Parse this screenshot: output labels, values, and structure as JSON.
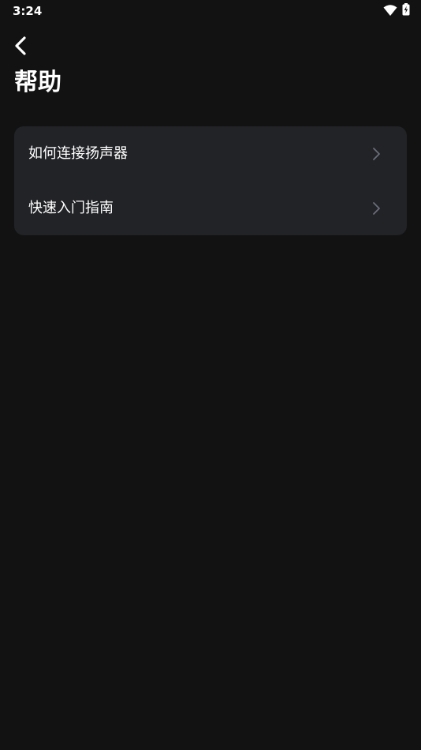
{
  "status_bar": {
    "time": "3:24",
    "icons": [
      "wifi-icon",
      "battery-charging-icon"
    ]
  },
  "header": {
    "back_icon": "chevron-left-icon",
    "title": "帮助"
  },
  "help_list": {
    "items": [
      {
        "label": "如何连接扬声器",
        "icon": "chevron-right-icon"
      },
      {
        "label": "快速入门指南",
        "icon": "chevron-right-icon"
      }
    ]
  },
  "colors": {
    "background": "#121212",
    "card": "#222327",
    "text": "#ffffff",
    "chevron": "#6b6e78"
  }
}
